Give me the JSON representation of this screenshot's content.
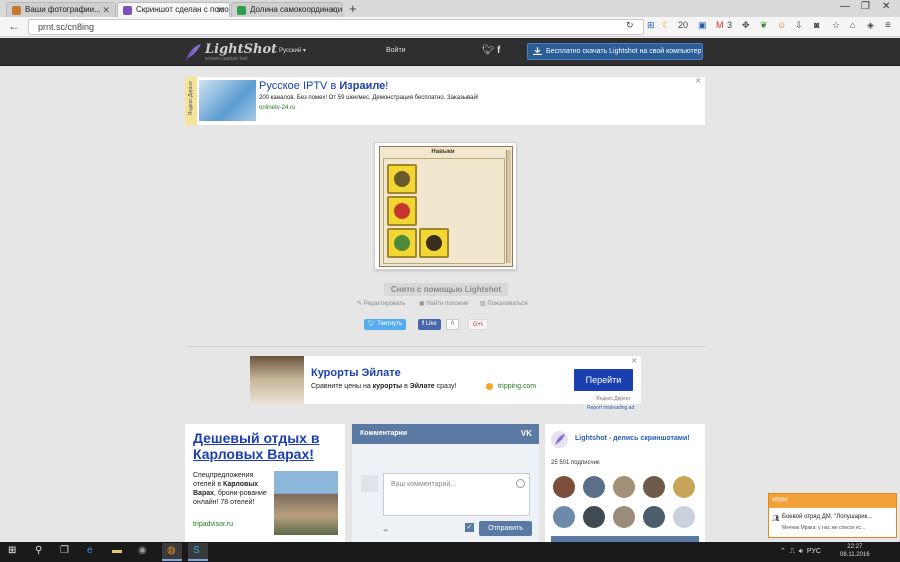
{
  "browser": {
    "tabs": [
      {
        "label": "Ваши фотографии...",
        "icon_color": "#c67a2e"
      },
      {
        "label": "Скриншот сделан с помощью...",
        "icon_color": "#7c4fbf",
        "active": true
      },
      {
        "label": "Долина самокоординаци...",
        "icon_color": "#2e9d4d"
      }
    ],
    "new_tab": "+",
    "url": "prnt.sc/cn8ing",
    "toolbar_counts": {
      "moon": "20",
      "gmail": "3"
    }
  },
  "header": {
    "logo_name": "LightShot",
    "logo_tagline": "screen capture tool",
    "lang": "Русский",
    "login": "Войти",
    "download_label": "Бесплатно скачать Lightshot на свой компьютер"
  },
  "ad_top": {
    "label": "Яндекс.Директ",
    "title_prefix": "Русское IPTV в ",
    "title_bold": "Израиле",
    "title_suffix": "!",
    "desc": "200 каналов. Без помех! От 59 шек/мес. Демонстрация бесплатно. Заказывай!",
    "url": "onlinetv-24.ru",
    "close": "✕"
  },
  "screenshot": {
    "panel_title": "Навыки",
    "caption": "Снято с помощью Lightshot"
  },
  "actions": {
    "edit": "Редактировать",
    "similar": "Найти похожие",
    "report": "Пожаловаться"
  },
  "share": {
    "twitter": "Твитнуть",
    "facebook": "Like",
    "fb_count": "0",
    "gplus": "G+I"
  },
  "ad_middle": {
    "title": "Курорты Эйлате",
    "desc_parts": [
      "Сравните цены на ",
      "курорты",
      " в ",
      "Эйлате",
      " сразу!"
    ],
    "url": "tripping.com",
    "button": "Перейти",
    "yandex": "Яндекс.Директ",
    "report": "Report misleading ad",
    "close": "✕"
  },
  "ad_left": {
    "title": "Дешевый отдых в Карловых Варах!",
    "desc_parts": [
      "Спецпредложения отелей в ",
      "Карловых Варах",
      ", брони-рование онлайн! 78 отелей!"
    ],
    "url": "tripadvisor.ru"
  },
  "comments": {
    "header": "Комментарии",
    "vk": "VK",
    "placeholder": "Ваш комментарий...",
    "send": "Отправить"
  },
  "vk_group": {
    "name": "Lightshot - делись скриншотами!",
    "subscribers": "25 501 подписчик",
    "face_colors": [
      "#7a4e3a",
      "#5c6f88",
      "#a39078",
      "#6e5b4a",
      "#c7a65a",
      "#6d8aa8",
      "#3f4a52",
      "#9a8b7a",
      "#4c5d6b",
      "#c9d2dc"
    ]
  },
  "skype": {
    "logo": "skype",
    "line1": "Боевой отряд ДМ. \"Лопушарик...",
    "line2": "Мечник Мрака: у нас же список ес..."
  },
  "taskbar": {
    "lang": "РУС",
    "time": "22:27",
    "date": "08.11.2016"
  }
}
